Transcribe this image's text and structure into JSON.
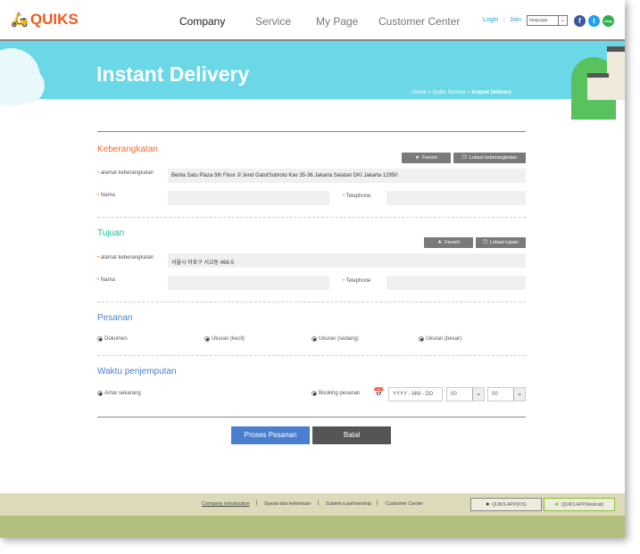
{
  "header": {
    "logo": "QUIKS",
    "nav": [
      "Company",
      "Service",
      "My Page",
      "Customer Center"
    ],
    "login": "Login",
    "join": "Join",
    "language": "language",
    "social": [
      {
        "name": "facebook",
        "label": "f",
        "color": "#3b5998"
      },
      {
        "name": "twitter",
        "label": "t",
        "color": "#1da1f2"
      },
      {
        "name": "blog",
        "label": "blog",
        "color": "#2db34a"
      }
    ]
  },
  "banner": {
    "title": "Instant Delivery",
    "breadcrumb": [
      "Home",
      "Quiks Service",
      "Instant Delivery"
    ]
  },
  "departure": {
    "title": "Keberangkatan",
    "favorite": "Favorit",
    "location_btn": "Lokasi keberangkatan",
    "address_label": "alamat keberangkatan",
    "address_value": "Berita Satu Plaza 5th Floor Jl Jend GatotSubroto Kav 35-36 Jakarta Selatan DKI Jakarta 12950",
    "name_label": "Nama",
    "name_value": "",
    "phone_label": "Telephone",
    "phone_value": ""
  },
  "destination": {
    "title": "Tujuan",
    "favorite": "Favorit",
    "location_btn": "Lokasi tujuan",
    "address_label": "alamat keberangkatan",
    "address_value": "서울시 마포구 서교동 466-5",
    "name_label": "Nama",
    "name_value": "",
    "phone_label": "Telephone",
    "phone_value": ""
  },
  "order": {
    "title": "Pesanan",
    "options": [
      "Dokumen",
      "Ukuran (kecil)",
      "Ukuran (sedang)",
      "Ukuran (besar)"
    ]
  },
  "pickup": {
    "title": "Waktu penjemputan",
    "now": "Antar sekarang",
    "booking": "Booking pesanan",
    "date_placeholder": "YYYY - MM - DD",
    "hour": "00",
    "minute": "00"
  },
  "actions": {
    "submit": "Proses Pesanan",
    "cancel": "Batal"
  },
  "footer": {
    "links": [
      "Company introduction",
      "Syarat dan ketentuan",
      "Submit a partnership",
      "Customer Center"
    ],
    "ios": "QUIKS APP(IOS)",
    "android": "QUIKS APP(Android)"
  },
  "colors": {
    "orange": "#f2692a",
    "teal": "#1abc9c",
    "blue": "#4a7fd0",
    "banner": "#6ad8e6"
  }
}
